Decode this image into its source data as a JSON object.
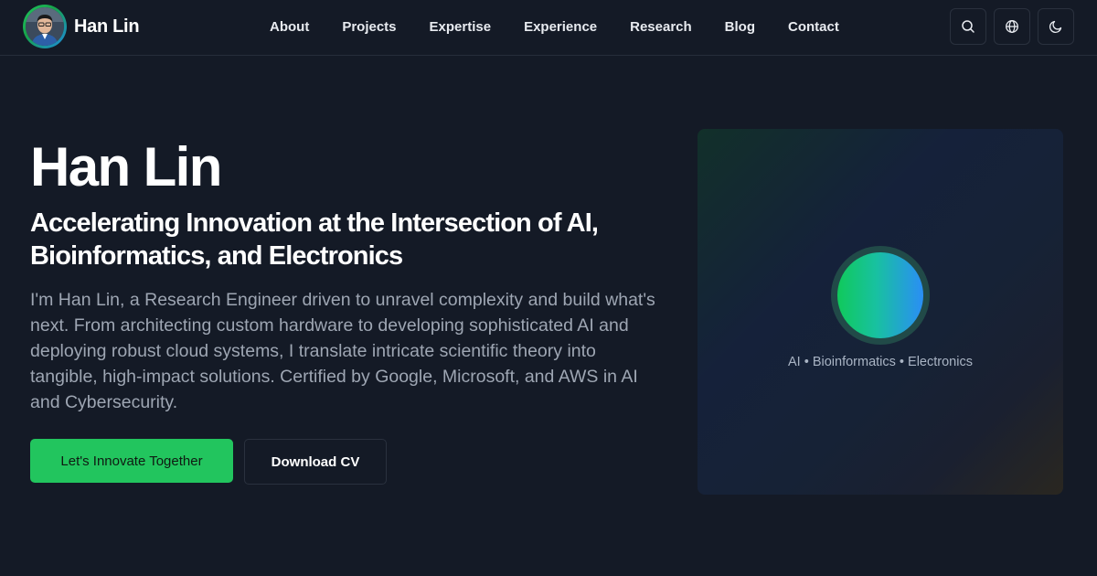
{
  "brand": {
    "name": "Han Lin",
    "avatar_alt": "Han Lin profile photo"
  },
  "nav": {
    "links": [
      "About",
      "Projects",
      "Expertise",
      "Experience",
      "Research",
      "Blog",
      "Contact"
    ]
  },
  "actions": {
    "icons": [
      "search-icon",
      "globe-icon",
      "moon-icon"
    ]
  },
  "hero": {
    "title": "Han Lin",
    "subtitle": "Accelerating Innovation at the Intersection of AI, Bioinformatics, and Electronics",
    "description": "I'm Han Lin, a Research Engineer driven to unravel complexity and build what's next. From architecting custom hardware to developing sophisticated AI and deploying robust cloud systems, I translate intricate scientific theory into tangible, high-impact solutions. Certified by Google, Microsoft, and AWS in AI and Cybersecurity.",
    "primary_button": "Let's Innovate Together",
    "secondary_button": "Download CV"
  },
  "card": {
    "tagline": "AI • Bioinformatics • Electronics"
  },
  "colors": {
    "background": "#141a26",
    "accent": "#22c55e",
    "text_muted": "#9ea6b3",
    "border": "#2a313e"
  }
}
